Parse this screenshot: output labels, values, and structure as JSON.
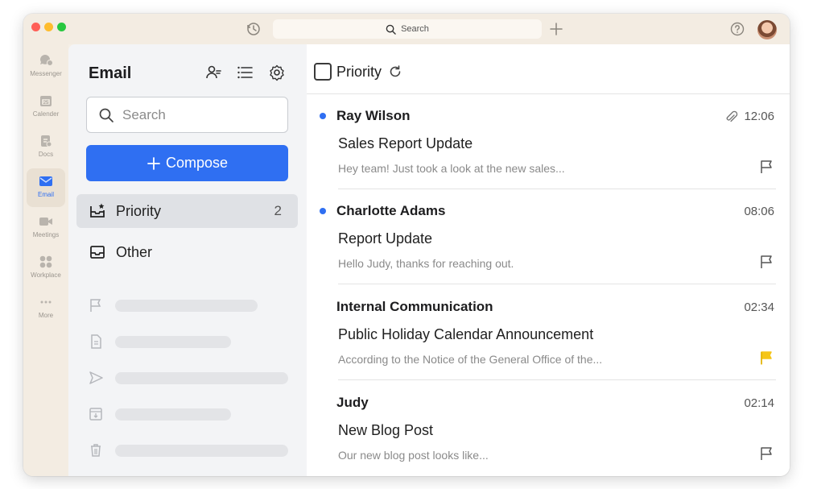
{
  "titlebar": {
    "search_label": "Search"
  },
  "rail": {
    "items": [
      {
        "label": "Messenger",
        "icon": "messenger-icon"
      },
      {
        "label": "Calender",
        "icon": "calendar-icon"
      },
      {
        "label": "Docs",
        "icon": "docs-icon"
      },
      {
        "label": "Email",
        "icon": "email-icon",
        "active": true
      },
      {
        "label": "Meetings",
        "icon": "meetings-icon"
      },
      {
        "label": "Workplace",
        "icon": "workplace-icon"
      },
      {
        "label": "More",
        "icon": "more-icon"
      }
    ]
  },
  "sidebar": {
    "title": "Email",
    "search_placeholder": "Search",
    "compose_label": "Compose",
    "folders": [
      {
        "label": "Priority",
        "count": "2",
        "icon": "priority-inbox-icon"
      },
      {
        "label": "Other",
        "icon": "inbox-icon"
      }
    ],
    "skeleton_icons": [
      "flag-icon",
      "draft-icon",
      "send-icon",
      "archive-icon",
      "trash-icon",
      "alert-icon"
    ]
  },
  "list": {
    "header_label": "Priority",
    "mails": [
      {
        "sender": "Ray Wilson",
        "time": "12:06",
        "subject": "Sales Report Update",
        "preview": "Hey team! Just took a look at the new sales...",
        "unread": true,
        "attachment": true,
        "flag_color": "#555555"
      },
      {
        "sender": "Charlotte Adams",
        "time": "08:06",
        "subject": "Report Update",
        "preview": "Hello Judy, thanks for reaching out.",
        "unread": true,
        "attachment": false,
        "flag_color": "#555555"
      },
      {
        "sender": "Internal Communication",
        "time": "02:34",
        "subject": "Public Holiday Calendar Announcement",
        "preview": "According to the Notice of the General Office of the...",
        "unread": false,
        "attachment": false,
        "flag_color": "#f5c518"
      },
      {
        "sender": "Judy",
        "time": "02:14",
        "subject": "New Blog Post",
        "preview": "Our new blog post looks like...",
        "unread": false,
        "attachment": false,
        "flag_color": "#555555"
      }
    ]
  },
  "colors": {
    "accent": "#2f6ff2",
    "flag_active": "#f5c518"
  }
}
